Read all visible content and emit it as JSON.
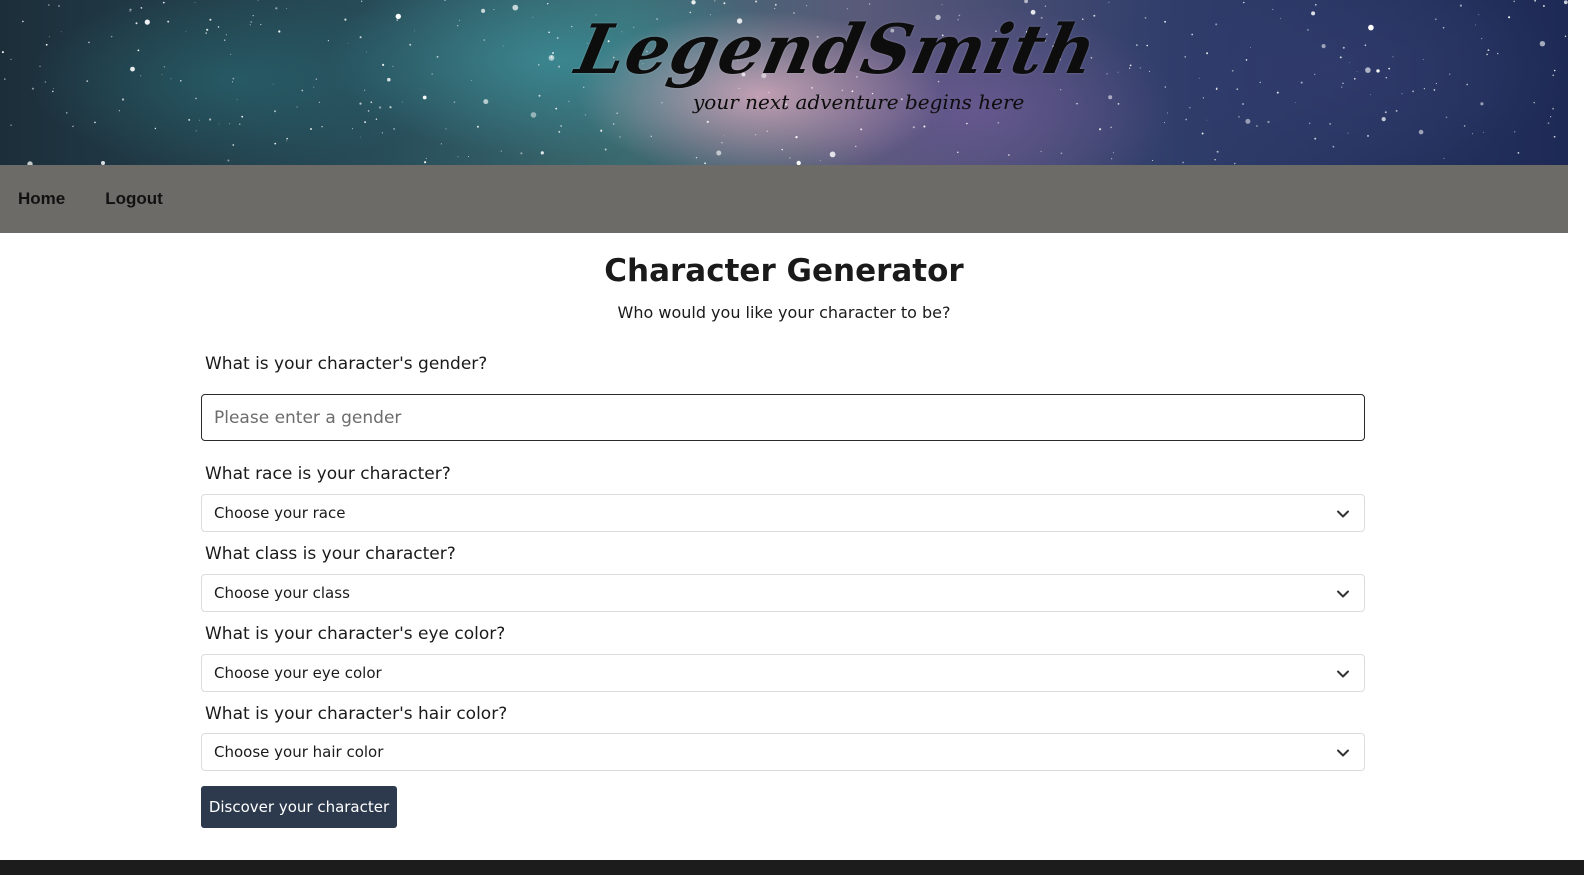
{
  "brand": {
    "logo_text": "LegendSmith",
    "tagline": "your next adventure begins here"
  },
  "nav": {
    "items": [
      {
        "label": "Home"
      },
      {
        "label": "Logout"
      }
    ]
  },
  "page": {
    "title": "Character Generator",
    "subtitle": "Who would you like your character to be?"
  },
  "form": {
    "gender": {
      "label": "What is your character's gender?",
      "placeholder": "Please enter a gender",
      "value": ""
    },
    "race": {
      "label": "What race is your character?",
      "selected": "Choose your race"
    },
    "class": {
      "label": "What class is your character?",
      "selected": "Choose your class"
    },
    "eye_color": {
      "label": "What is your character's eye color?",
      "selected": "Choose your eye color"
    },
    "hair_color": {
      "label": "What is your character's hair color?",
      "selected": "Choose your hair color"
    },
    "submit_label": "Discover your character"
  },
  "icons": {
    "select_chevron": "chevron-down-icon"
  },
  "colors": {
    "nav_bg": "#6c6b67",
    "button_bg": "#2d3a4e",
    "button_text": "#ffffff"
  }
}
